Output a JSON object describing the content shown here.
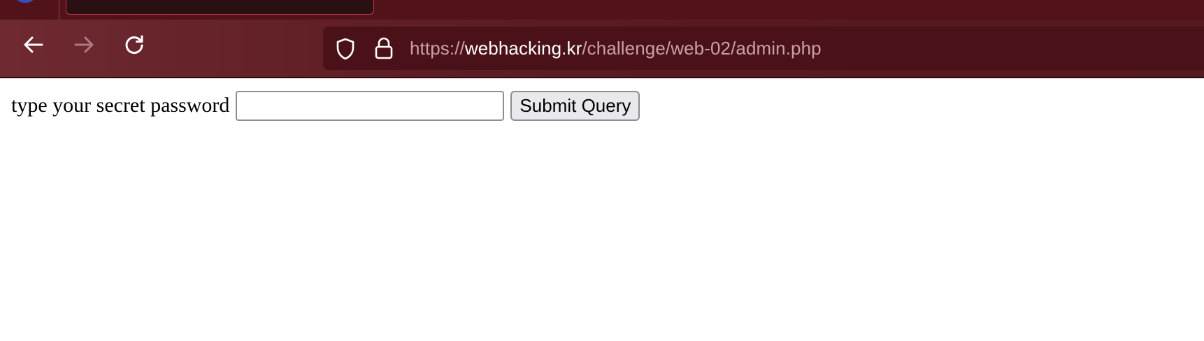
{
  "browser": {
    "url": {
      "scheme": "https://",
      "host": "webhacking.kr",
      "path": "/challenge/web-02/admin.php"
    },
    "icons": {
      "back": "arrow-left-icon",
      "forward": "arrow-right-icon",
      "reload": "reload-icon",
      "tracking_protection": "shield-icon",
      "site_security": "lock-icon"
    },
    "colors": {
      "toolbar": "#5f1f25",
      "tabstrip": "#521219",
      "urlbar": "#4a1218",
      "active_tab_border": "#c0394a"
    }
  },
  "page": {
    "prompt": "type your secret password",
    "password_input": {
      "value": "",
      "placeholder": ""
    },
    "submit_label": "Submit Query"
  }
}
